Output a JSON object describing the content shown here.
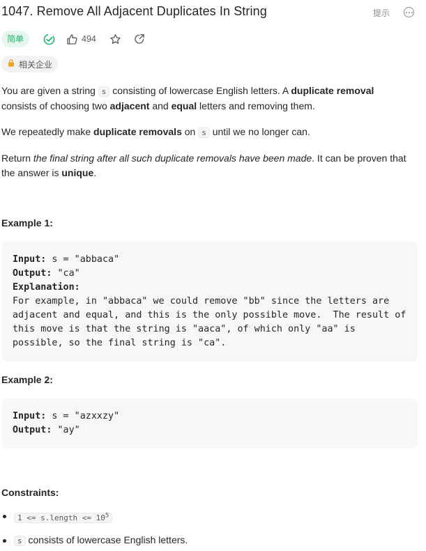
{
  "header": {
    "title": "1047. Remove All Adjacent Duplicates In String",
    "hint_label": "提示"
  },
  "meta": {
    "difficulty": "简单",
    "likes": "494"
  },
  "tag": {
    "label": "相关企业"
  },
  "description": {
    "p1_a": "You are given a string ",
    "p1_code": "s",
    "p1_b": " consisting of lowercase English letters. A ",
    "p1_bold1": "duplicate removal",
    "p1_c": " consists of choosing two ",
    "p1_bold2": "adjacent",
    "p1_d": " and ",
    "p1_bold3": "equal",
    "p1_e": " letters and removing them.",
    "p2_a": "We repeatedly make ",
    "p2_bold": "duplicate removals",
    "p2_b": " on ",
    "p2_code": "s",
    "p2_c": " until we no longer can.",
    "p3_a": "Return ",
    "p3_italic": "the final string after all such duplicate removals have been made",
    "p3_b": ". It can be proven that the answer is ",
    "p3_bold": "unique",
    "p3_c": "."
  },
  "examples": [
    {
      "title": "Example 1:",
      "input_label": "Input:",
      "input": " s = \"abbaca\"",
      "output_label": "Output:",
      "output": " \"ca\"",
      "explanation_label": "Explanation:",
      "explanation": "For example, in \"abbaca\" we could remove \"bb\" since the letters are adjacent and equal, and this is the only possible move.  The result of this move is that the string is \"aaca\", of which only \"aa\" is possible, so the final string is \"ca\"."
    },
    {
      "title": "Example 2:",
      "input_label": "Input:",
      "input": " s = \"azxxzy\"",
      "output_label": "Output:",
      "output": " \"ay\""
    }
  ],
  "constraints": {
    "title": "Constraints:",
    "c1_code": "1 <= s.length <= 10",
    "c1_sup": "5",
    "c2_code": "s",
    "c2_text": " consists of lowercase English letters."
  }
}
